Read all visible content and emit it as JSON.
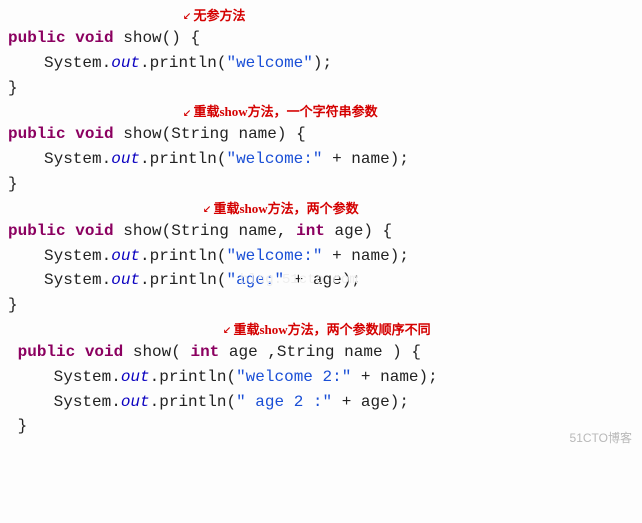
{
  "annotations": {
    "a1": "无参方法",
    "a2": "重载show方法，一个字符串参数",
    "a3": "重载show方法，两个参数",
    "a4": "重载show方法，两个参数顺序不同"
  },
  "code": {
    "kw_public": "public",
    "kw_void": "void",
    "kw_int": "int",
    "method_name": "show",
    "param_string": "String",
    "param_name": "name",
    "param_age": "age",
    "sys": "System",
    "out": "out",
    "println": "println",
    "str_welcome": "\"welcome\"",
    "str_welcome_colon": "\"welcome:\"",
    "str_age_colon": "\"age:\"",
    "str_welcome2": "\"welcome 2:\"",
    "str_age2": "\" age 2 :\"",
    "brace_open": "{",
    "brace_close": "}",
    "paren_open": "(",
    "paren_close": ")",
    "semi": ";",
    "comma": ",",
    "plus": " + ",
    "dot": "."
  },
  "watermark": "51CTO博客",
  "center_watermark": "blog.51cto.com"
}
